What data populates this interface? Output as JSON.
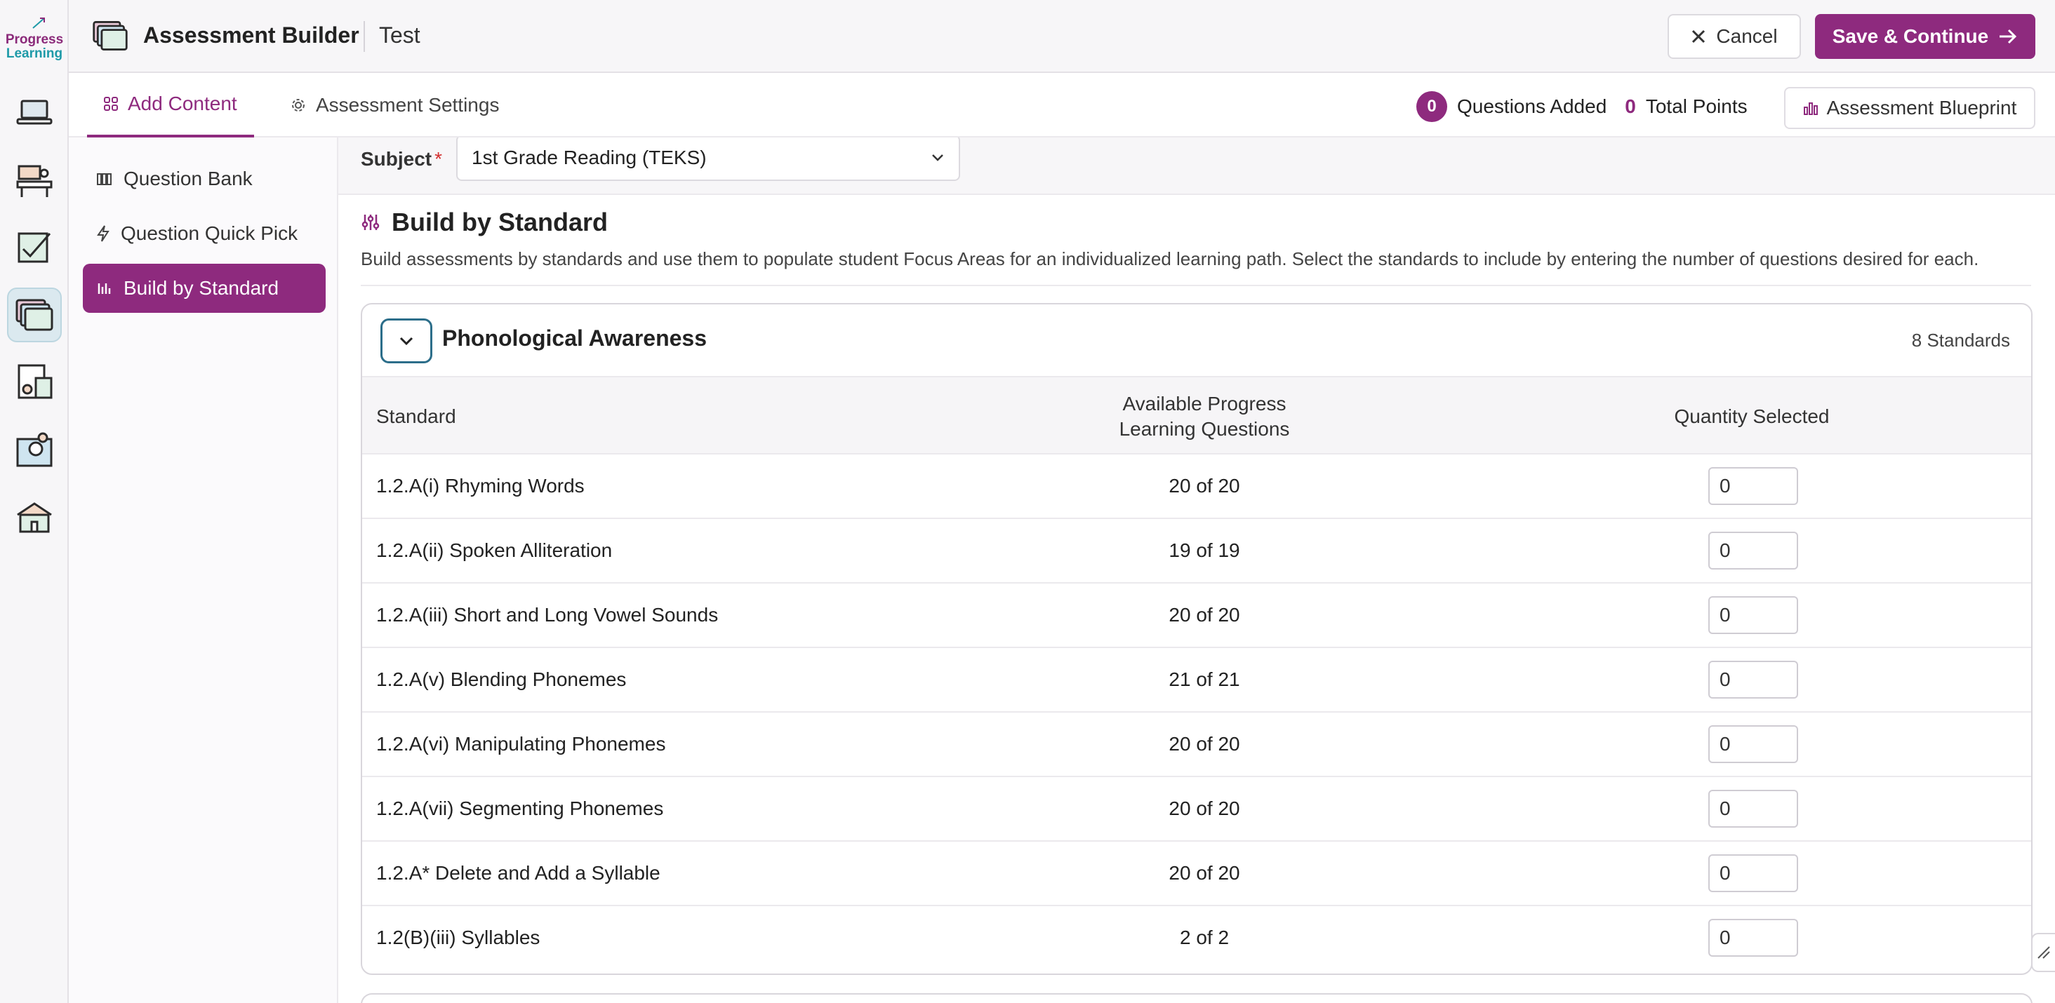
{
  "logo": {
    "line1": "Progress",
    "line2": "Learning"
  },
  "header": {
    "app_title": "Assessment Builder",
    "doc_name": "Test",
    "cancel_label": "Cancel",
    "save_label": "Save & Continue"
  },
  "rail": {
    "icons": [
      "laptop-icon",
      "teacher-desk-icon",
      "graded-paper-icon",
      "assessment-stack-icon",
      "report-chart-icon",
      "book-gear-icon",
      "school-icon"
    ],
    "active_index": 3
  },
  "tabs": [
    {
      "label": "Add Content",
      "icon": "grid-icon",
      "active": true
    },
    {
      "label": "Assessment Settings",
      "icon": "gear-icon",
      "active": false
    }
  ],
  "summary": {
    "questions_added_count": "0",
    "questions_added_label": "Questions Added",
    "total_points_count": "0",
    "total_points_label": "Total Points",
    "blueprint_label": "Assessment Blueprint"
  },
  "subnav": {
    "items": [
      {
        "label": "Question Bank",
        "icon": "books-icon",
        "active": false
      },
      {
        "label": "Question Quick Pick",
        "icon": "lightning-icon",
        "active": false
      },
      {
        "label": "Build by Standard",
        "icon": "bars-icon",
        "active": true
      }
    ]
  },
  "subject": {
    "label": "Subject",
    "required_mark": "*",
    "value": "1st Grade Reading (TEKS)"
  },
  "section": {
    "title": "Build by Standard",
    "description": "Build assessments by standards and use them to populate student Focus Areas for an individualized learning path. Select the standards to include by entering the number of questions desired for each."
  },
  "group": {
    "title": "Phonological Awareness",
    "count_label": "8 Standards",
    "headers": {
      "standard": "Standard",
      "available_line1": "Available Progress",
      "available_line2": "Learning Questions",
      "quantity": "Quantity Selected"
    },
    "rows": [
      {
        "standard": "1.2.A(i) Rhyming Words",
        "available": "20 of 20",
        "quantity": "0"
      },
      {
        "standard": "1.2.A(ii) Spoken Alliteration",
        "available": "19 of 19",
        "quantity": "0"
      },
      {
        "standard": "1.2.A(iii) Short and Long Vowel Sounds",
        "available": "20 of 20",
        "quantity": "0"
      },
      {
        "standard": "1.2.A(v) Blending Phonemes",
        "available": "21 of 21",
        "quantity": "0"
      },
      {
        "standard": "1.2.A(vi) Manipulating Phonemes",
        "available": "20 of 20",
        "quantity": "0"
      },
      {
        "standard": "1.2.A(vii) Segmenting Phonemes",
        "available": "20 of 20",
        "quantity": "0"
      },
      {
        "standard": "1.2.A* Delete and Add a Syllable",
        "available": "20 of 20",
        "quantity": "0"
      },
      {
        "standard": "1.2(B)(iii) Syllables",
        "available": "2 of 2",
        "quantity": "0"
      }
    ]
  },
  "colors": {
    "brand": "#8e2a7e",
    "accent_teal": "#2c6e8a",
    "required": "#d32f2f"
  }
}
